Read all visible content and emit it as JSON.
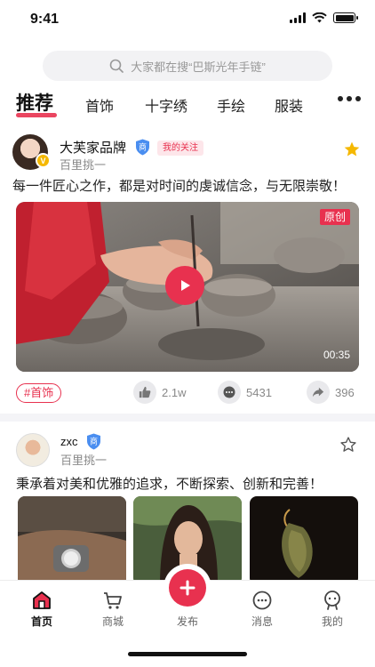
{
  "status_bar": {
    "time": "9:41"
  },
  "search": {
    "placeholder": "大家都在搜“巴斯光年手链”"
  },
  "tabs": [
    "推荐",
    "首饰",
    "十字绣",
    "手绘",
    "服装"
  ],
  "active_tab": "推荐",
  "posts": [
    {
      "author": "大芙家品牌",
      "badge": "V",
      "merchant_icon": "商",
      "follow_tag": "我的关注",
      "subtitle": "百里挑一",
      "text": "每一件匠心之作，都是对时间的虔诚信念，与无限崇敬！",
      "media_tag": "原创",
      "duration": "00:35",
      "topic": "#首饰",
      "likes": "2.1w",
      "comments": "5431",
      "shares": "396",
      "starred": true
    },
    {
      "author": "zxc",
      "merchant_icon": "商",
      "subtitle": "百里挑一",
      "text": "秉承着对美和优雅的追求，不断探索、创新和完善！",
      "starred": false
    }
  ],
  "bottom_nav": {
    "home": "首页",
    "shop": "商城",
    "post": "发布",
    "messages": "消息",
    "mine": "我的"
  },
  "colors": {
    "accent": "#e8314f",
    "gold": "#f5b800",
    "merchant_blue": "#4a8ef0"
  }
}
